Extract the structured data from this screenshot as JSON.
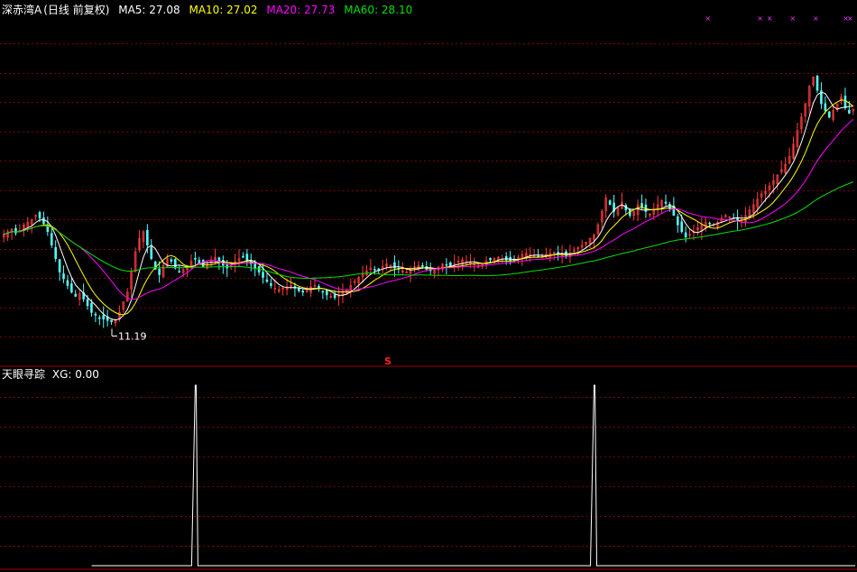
{
  "stock": {
    "name": "深赤湾A",
    "period": "(日线 前复权)"
  },
  "ma_legend": [
    {
      "label": "MA5: 27.08",
      "color": "#ffffff"
    },
    {
      "label": "MA10: 27.02",
      "color": "#ffff00"
    },
    {
      "label": "MA20: 27.73",
      "color": "#ff00ff"
    },
    {
      "label": "MA60: 28.10",
      "color": "#00e000"
    }
  ],
  "indicator": {
    "name": "天眼寻踪",
    "value_label": "XG: 0.00"
  },
  "annotations": {
    "low_price": "11.19",
    "signal_marker": "S"
  },
  "colors": {
    "background": "#000000",
    "up": "#ff3c3c",
    "down": "#54fcfc",
    "grid": "#7a0000",
    "border": "#a00000",
    "signal": "#ffffff"
  },
  "chart_data": [
    {
      "type": "line",
      "title": "深赤湾A (日线 前复权)",
      "description_series": "candlestick with moving averages",
      "ylim": [
        8,
        34
      ],
      "low_point": {
        "index": 28,
        "value": 11.19
      },
      "series": [
        {
          "name": "MA5",
          "last": 27.08
        },
        {
          "name": "MA10",
          "last": 27.02
        },
        {
          "name": "MA20",
          "last": 27.73
        },
        {
          "name": "MA60",
          "last": 28.1
        }
      ],
      "close": [
        17.8,
        18.0,
        18.2,
        17.9,
        18.1,
        18.5,
        18.7,
        18.9,
        19.2,
        19.0,
        18.6,
        18.0,
        17.0,
        16.0,
        15.0,
        14.5,
        14.0,
        13.5,
        13.2,
        13.4,
        13.0,
        12.5,
        12.0,
        11.8,
        11.6,
        11.5,
        11.4,
        11.3,
        11.4,
        12.0,
        12.8,
        13.5,
        15.0,
        16.5,
        17.5,
        18.0,
        17.0,
        16.0,
        15.2,
        14.8,
        15.5,
        16.0,
        15.8,
        15.3,
        15.0,
        15.2,
        15.5,
        15.8,
        16.0,
        15.7,
        15.4,
        15.6,
        15.9,
        16.1,
        15.8,
        15.5,
        15.3,
        15.5,
        15.8,
        16.0,
        16.1,
        15.9,
        15.6,
        15.3,
        15.0,
        14.6,
        14.3,
        14.0,
        13.8,
        13.7,
        13.8,
        13.9,
        14.0,
        13.8,
        13.6,
        13.5,
        13.7,
        13.9,
        14.0,
        13.8,
        13.5,
        13.3,
        13.2,
        13.1,
        13.3,
        13.5,
        13.7,
        14.0,
        14.3,
        14.6,
        14.9,
        15.1,
        15.3,
        15.2,
        15.1,
        15.4,
        15.6,
        15.5,
        15.3,
        15.2,
        15.1,
        15.0,
        15.2,
        15.4,
        15.5,
        15.4,
        15.2,
        15.1,
        15.2,
        15.4,
        15.6,
        15.5,
        15.4,
        15.6,
        15.8,
        15.9,
        15.8,
        15.7,
        15.6,
        15.5,
        15.6,
        15.8,
        15.9,
        16.0,
        16.1,
        16.0,
        15.9,
        15.8,
        15.9,
        16.1,
        16.3,
        16.4,
        16.3,
        16.2,
        16.1,
        16.2,
        16.3,
        16.4,
        16.5,
        16.4,
        16.3,
        16.2,
        16.4,
        16.6,
        16.8,
        17.0,
        17.2,
        17.5,
        17.8,
        18.5,
        19.5,
        20.5,
        20.0,
        19.5,
        19.8,
        20.2,
        19.6,
        19.2,
        19.5,
        20.0,
        19.8,
        19.5,
        19.3,
        19.6,
        20.0,
        20.3,
        20.1,
        19.7,
        19.2,
        18.5,
        18.0,
        17.6,
        17.8,
        18.0,
        18.3,
        18.5,
        18.7,
        18.6,
        18.5,
        18.7,
        19.0,
        19.2,
        19.1,
        19.0,
        18.8,
        18.9,
        19.2,
        19.6,
        20.0,
        20.4,
        20.8,
        21.0,
        21.4,
        21.8,
        22.2,
        22.6,
        23.0,
        23.6,
        24.5,
        25.5,
        26.5,
        27.5,
        28.8,
        29.5,
        28.5,
        27.5,
        27.0,
        26.5,
        27.0,
        27.5,
        28.0,
        27.2,
        26.8,
        27.1
      ]
    },
    {
      "type": "bar",
      "title": "天眼寻踪",
      "series": [
        {
          "name": "XG",
          "last": 0.0
        }
      ],
      "signal_indices": [
        48,
        148
      ],
      "signal_value": 1
    }
  ]
}
